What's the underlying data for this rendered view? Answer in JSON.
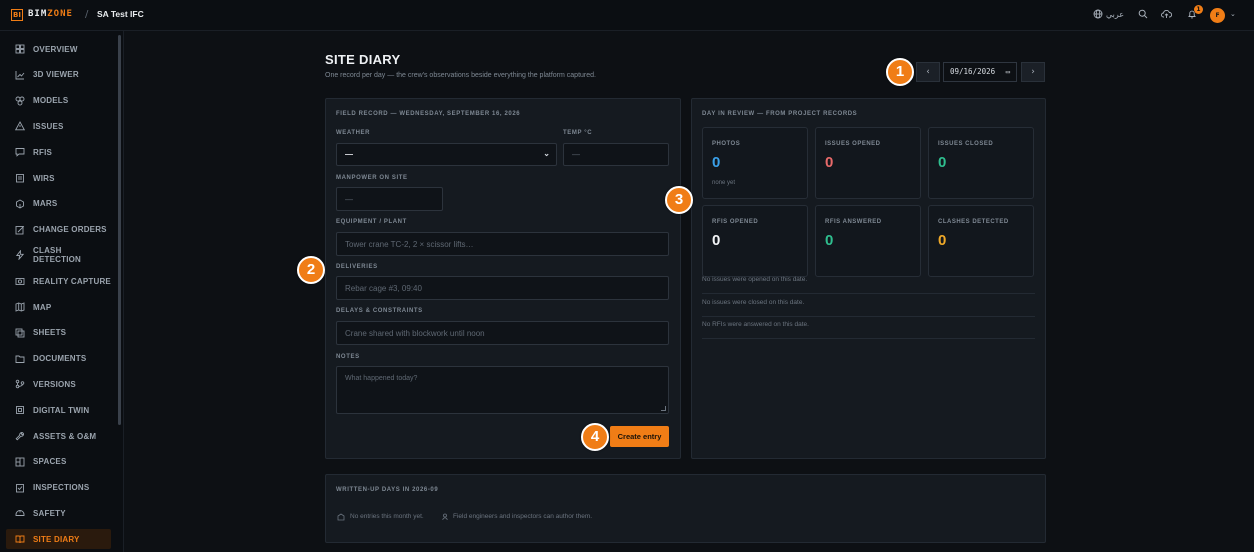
{
  "app": {
    "logo_mark": "BI",
    "logo_text_a": "BIM",
    "logo_text_b": "ZONE",
    "crumb_separator": "/",
    "project": "SA Test IFC",
    "language": "عربي",
    "notification_count": "1",
    "avatar_initial": "F",
    "accent_color": "#f07d16"
  },
  "sidebar": {
    "items": [
      {
        "label": "OVERVIEW",
        "icon": "overview-icon"
      },
      {
        "label": "3D VIEWER",
        "icon": "chart-icon"
      },
      {
        "label": "MODELS",
        "icon": "models-icon"
      },
      {
        "label": "ISSUES",
        "icon": "warning-icon"
      },
      {
        "label": "RFIS",
        "icon": "message-icon"
      },
      {
        "label": "WIRS",
        "icon": "clipboard-icon"
      },
      {
        "label": "MARS",
        "icon": "package-icon"
      },
      {
        "label": "CHANGE ORDERS",
        "icon": "edit-icon"
      },
      {
        "label": "CLASH DETECTION",
        "icon": "zap-icon"
      },
      {
        "label": "REALITY CAPTURE",
        "icon": "camera-icon"
      },
      {
        "label": "MAP",
        "icon": "map-icon"
      },
      {
        "label": "SHEETS",
        "icon": "sheets-icon"
      },
      {
        "label": "DOCUMENTS",
        "icon": "folder-icon"
      },
      {
        "label": "VERSIONS",
        "icon": "branch-icon"
      },
      {
        "label": "DIGITAL TWIN",
        "icon": "twin-icon"
      },
      {
        "label": "ASSETS & O&M",
        "icon": "wrench-icon"
      },
      {
        "label": "SPACES",
        "icon": "spaces-icon"
      },
      {
        "label": "INSPECTIONS",
        "icon": "checklist-icon"
      },
      {
        "label": "SAFETY",
        "icon": "helmet-icon"
      },
      {
        "label": "SITE DIARY",
        "icon": "book-icon",
        "active": true
      }
    ]
  },
  "page": {
    "title": "SITE DIARY",
    "subtitle": "One record per day — the crew's observations beside everything the platform captured.",
    "date_value": "09/16/2026",
    "prev_label": "‹",
    "next_label": "›"
  },
  "field_record": {
    "title": "FIELD RECORD — WEDNESDAY, SEPTEMBER 16, 2026",
    "weather_label": "WEATHER",
    "weather_value": "—",
    "temp_label": "TEMP °C",
    "temp_placeholder": "—",
    "manpower_label": "MANPOWER ON SITE",
    "manpower_placeholder": "—",
    "equipment_label": "EQUIPMENT / PLANT",
    "equipment_placeholder": "Tower crane TC-2, 2 × scissor lifts…",
    "deliveries_label": "DELIVERIES",
    "deliveries_placeholder": "Rebar cage #3, 09:40",
    "delays_label": "DELAYS & CONSTRAINTS",
    "delays_placeholder": "Crane shared with blockwork until noon",
    "notes_label": "NOTES",
    "notes_placeholder": "What happened today?",
    "create_label": "Create entry"
  },
  "review": {
    "title": "DAY IN REVIEW — FROM PROJECT RECORDS",
    "stats": [
      {
        "label": "PHOTOS",
        "value": "0",
        "color": "#3aa0e8",
        "note": "none yet"
      },
      {
        "label": "ISSUES OPENED",
        "value": "0",
        "color": "#e86a6a",
        "note": ""
      },
      {
        "label": "ISSUES CLOSED",
        "value": "0",
        "color": "#2fbf8f",
        "note": ""
      },
      {
        "label": "RFIS OPENED",
        "value": "0",
        "color": "#f2f4f6",
        "note": ""
      },
      {
        "label": "RFIS ANSWERED",
        "value": "0",
        "color": "#2fbf8f",
        "note": ""
      },
      {
        "label": "CLASHES DETECTED",
        "value": "0",
        "color": "#f0a928",
        "note": ""
      }
    ],
    "lines": [
      "No issues were opened on this date.",
      "No issues were closed on this date.",
      "No RFIs were answered on this date."
    ]
  },
  "written_days": {
    "title": "WRITTEN-UP DAYS IN 2026-09",
    "empty": "No entries this month yet.",
    "hint": "Field engineers and inspectors can author them."
  },
  "markers": [
    "1",
    "2",
    "3",
    "4"
  ]
}
